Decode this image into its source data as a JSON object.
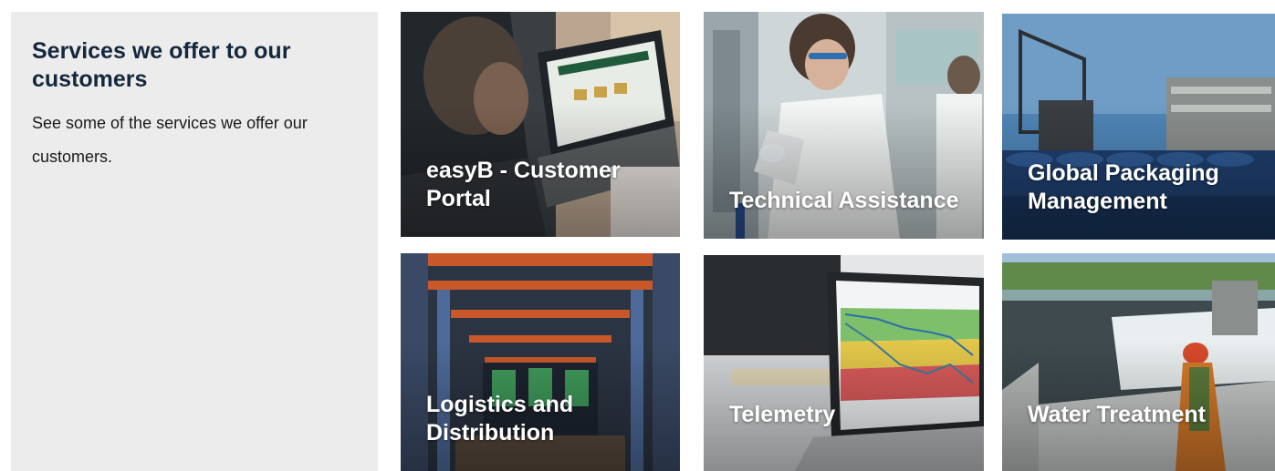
{
  "intro": {
    "title": "Services we offer to our customers",
    "description": "See some of the services we offer our customers."
  },
  "services": [
    {
      "label": "easyB - Customer Portal",
      "image": "laptop-user-photo"
    },
    {
      "label": "Technical Assistance",
      "image": "lab-technician-photo"
    },
    {
      "label": "Global Packaging Management",
      "image": "drum-storage-yard-photo"
    },
    {
      "label": "Logistics and Distribution",
      "image": "warehouse-racks-photo"
    },
    {
      "label": "Telemetry",
      "image": "laptop-telemetry-chart-photo"
    },
    {
      "label": "Water Treatment",
      "image": "water-treatment-plant-photo"
    }
  ],
  "colors": {
    "intro_background": "#ececec",
    "title_color": "#15273d",
    "label_color": "#ffffff"
  }
}
